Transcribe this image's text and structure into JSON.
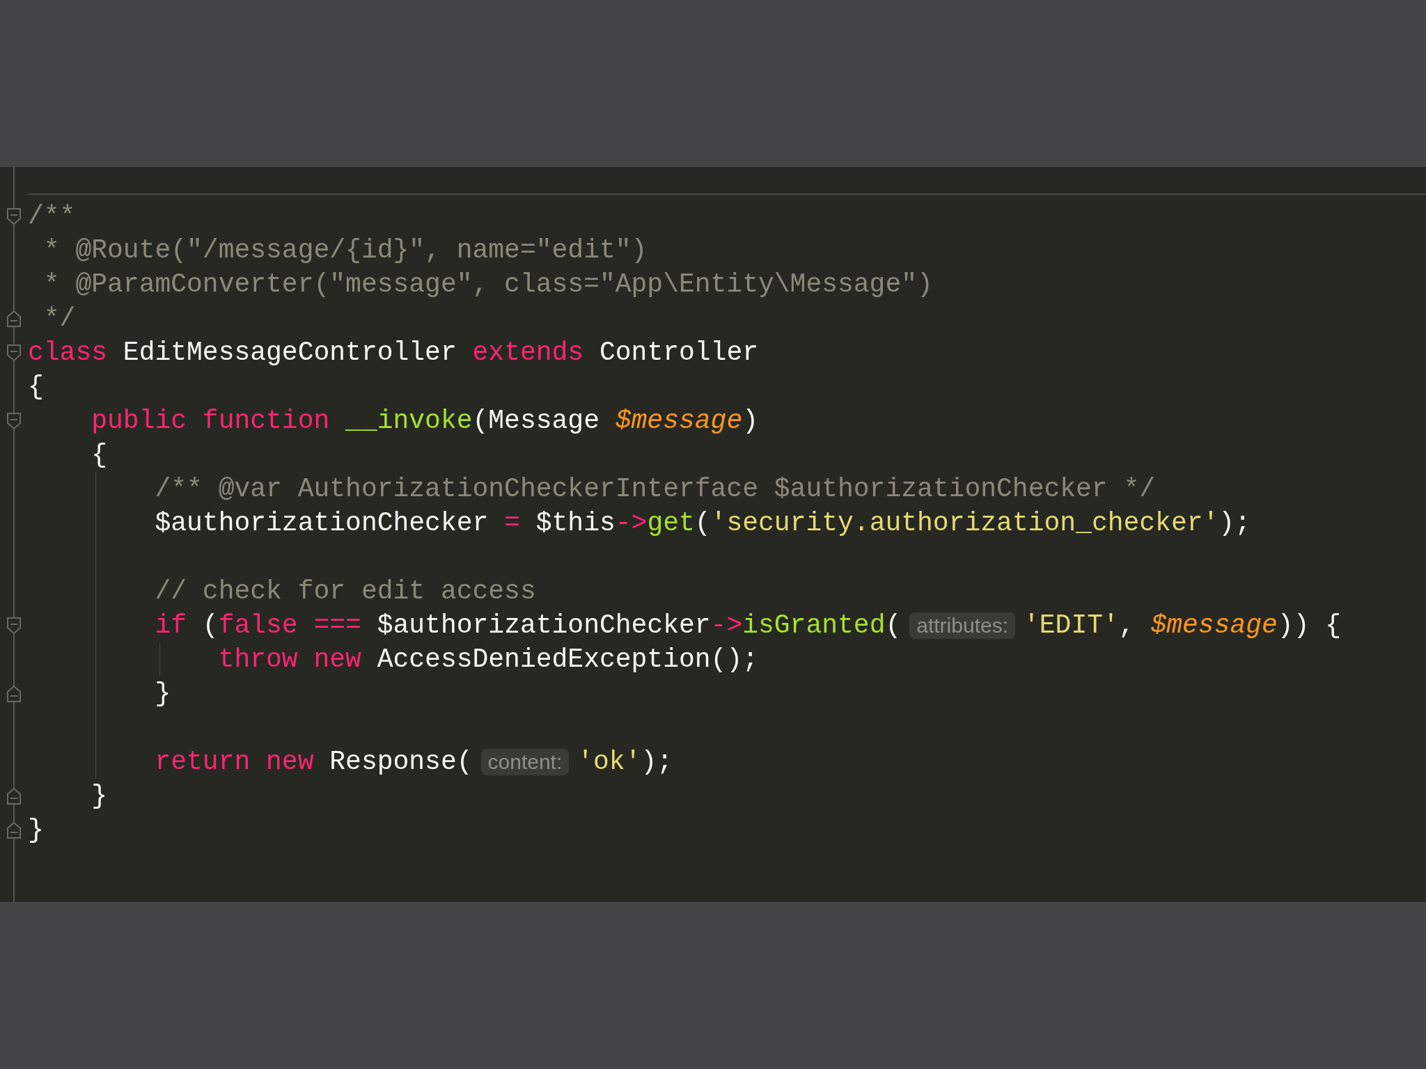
{
  "editor": {
    "lines": [
      {
        "fold_start": true,
        "fold_end": false,
        "tokens": [
          {
            "kind": "comment",
            "text": "/**"
          }
        ]
      },
      {
        "fold_start": false,
        "fold_end": false,
        "tokens": [
          {
            "kind": "comment",
            "text": " * @Route(\"/message/{id}\", name=\"edit\")"
          }
        ]
      },
      {
        "fold_start": false,
        "fold_end": false,
        "tokens": [
          {
            "kind": "comment",
            "text": " * @ParamConverter(\"message\", class=\"App\\Entity\\Message\")"
          }
        ]
      },
      {
        "fold_start": false,
        "fold_end": true,
        "tokens": [
          {
            "kind": "comment",
            "text": " */"
          }
        ]
      },
      {
        "fold_start": true,
        "fold_end": false,
        "tokens": [
          {
            "kind": "keyword",
            "text": "class"
          },
          {
            "kind": "plain",
            "text": " EditMessageController "
          },
          {
            "kind": "keyword",
            "text": "extends"
          },
          {
            "kind": "plain",
            "text": " Controller"
          }
        ]
      },
      {
        "fold_start": false,
        "fold_end": false,
        "tokens": [
          {
            "kind": "plain",
            "text": "{"
          }
        ]
      },
      {
        "fold_start": true,
        "fold_end": false,
        "tokens": [
          {
            "kind": "keyword",
            "text": "    public function "
          },
          {
            "kind": "function",
            "text": "__invoke"
          },
          {
            "kind": "plain",
            "text": "(Message "
          },
          {
            "kind": "variable",
            "text": "$message"
          },
          {
            "kind": "plain",
            "text": ")"
          }
        ]
      },
      {
        "fold_start": false,
        "fold_end": false,
        "tokens": [
          {
            "kind": "plain",
            "text": "    {"
          }
        ]
      },
      {
        "fold_start": false,
        "fold_end": false,
        "tokens": [
          {
            "kind": "comment",
            "text": "        /** @var AuthorizationCheckerInterface $authorizationChecker */"
          }
        ]
      },
      {
        "fold_start": false,
        "fold_end": false,
        "tokens": [
          {
            "kind": "plain",
            "text": "        $authorizationChecker "
          },
          {
            "kind": "operator",
            "text": "="
          },
          {
            "kind": "plain",
            "text": " $this"
          },
          {
            "kind": "operator",
            "text": "->"
          },
          {
            "kind": "function",
            "text": "get"
          },
          {
            "kind": "plain",
            "text": "("
          },
          {
            "kind": "string",
            "text": "'security.authorization_checker'"
          },
          {
            "kind": "plain",
            "text": ");"
          }
        ]
      },
      {
        "fold_start": false,
        "fold_end": false
      },
      {
        "fold_start": false,
        "fold_end": false,
        "tokens": [
          {
            "kind": "comment",
            "text": "        // check for edit access"
          }
        ]
      },
      {
        "fold_start": true,
        "fold_end": false,
        "tokens": [
          {
            "kind": "keyword",
            "text": "        if"
          },
          {
            "kind": "plain",
            "text": " ("
          },
          {
            "kind": "keyword",
            "text": "false "
          },
          {
            "kind": "operator",
            "text": "==="
          },
          {
            "kind": "plain",
            "text": " $authorizationChecker"
          },
          {
            "kind": "operator",
            "text": "->"
          },
          {
            "kind": "function",
            "text": "isGranted"
          },
          {
            "kind": "plain",
            "text": "("
          },
          {
            "kind": "hint",
            "text": "attributes:"
          },
          {
            "kind": "string",
            "text": "'EDIT'"
          },
          {
            "kind": "plain",
            "text": ", "
          },
          {
            "kind": "variable",
            "text": "$message"
          },
          {
            "kind": "plain",
            "text": ")) {"
          }
        ]
      },
      {
        "fold_start": false,
        "fold_end": false,
        "tokens": [
          {
            "kind": "keyword",
            "text": "            throw new"
          },
          {
            "kind": "plain",
            "text": " AccessDeniedException();"
          }
        ]
      },
      {
        "fold_start": false,
        "fold_end": true,
        "tokens": [
          {
            "kind": "plain",
            "text": "        }"
          }
        ]
      },
      {
        "fold_start": false,
        "fold_end": false
      },
      {
        "fold_start": false,
        "fold_end": false,
        "tokens": [
          {
            "kind": "keyword",
            "text": "        return new"
          },
          {
            "kind": "plain",
            "text": " Response("
          },
          {
            "kind": "hint",
            "text": "content:"
          },
          {
            "kind": "string",
            "text": "'ok'"
          },
          {
            "kind": "plain",
            "text": ");"
          }
        ]
      },
      {
        "fold_start": false,
        "fold_end": true,
        "tokens": [
          {
            "kind": "plain",
            "text": "    }"
          }
        ]
      },
      {
        "fold_start": false,
        "fold_end": true,
        "tokens": [
          {
            "kind": "plain",
            "text": "}"
          }
        ]
      }
    ]
  }
}
